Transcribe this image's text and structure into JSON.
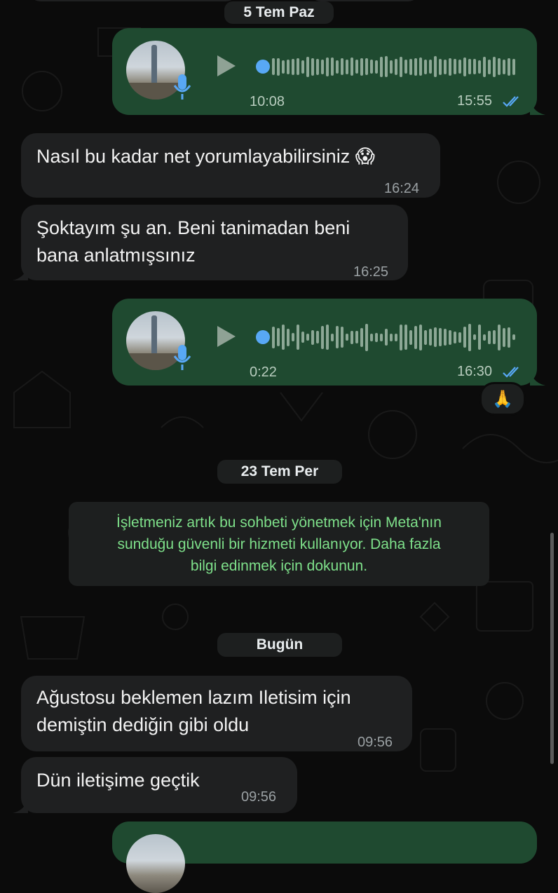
{
  "chat": {
    "date_1": "5 Tem Paz",
    "voice_1": {
      "duration": "10:08",
      "time": "15:55"
    },
    "msg_1": {
      "text": "Nasıl bu kadar net yorumlayabilirsiniz 😱",
      "time": "16:24"
    },
    "msg_2": {
      "line1": "Şoktayım şu an. Beni tanimadan beni",
      "line2": "bana anlatmışsınız",
      "time": "16:25"
    },
    "voice_2": {
      "duration": "0:22",
      "time": "16:30",
      "reaction": "🙏"
    },
    "date_2": "23 Tem Per",
    "system_notice": {
      "line1": "İşletmeniz artık bu sohbeti yönetmek için Meta'nın",
      "line2": "sunduğu güvenli bir hizmeti kullanıyor. Daha fazla",
      "line3": "bilgi edinmek için dokunun."
    },
    "date_3": "Bugün",
    "msg_3": {
      "line1": "Ağustosu beklemen lazım Iletisim için",
      "line2": "demiştin dediğin gibi oldu",
      "time": "09:56"
    },
    "msg_4": {
      "text": "Dün iletişime geçtik",
      "time": "09:56"
    }
  },
  "icons": {
    "mic": "mic-icon",
    "play": "play-icon",
    "read": "double-check-icon"
  },
  "colors": {
    "outgoing": "#1f4a30",
    "incoming": "#1f2021",
    "system_text": "#7ee08a",
    "read_ticks": "#58a8f5"
  }
}
